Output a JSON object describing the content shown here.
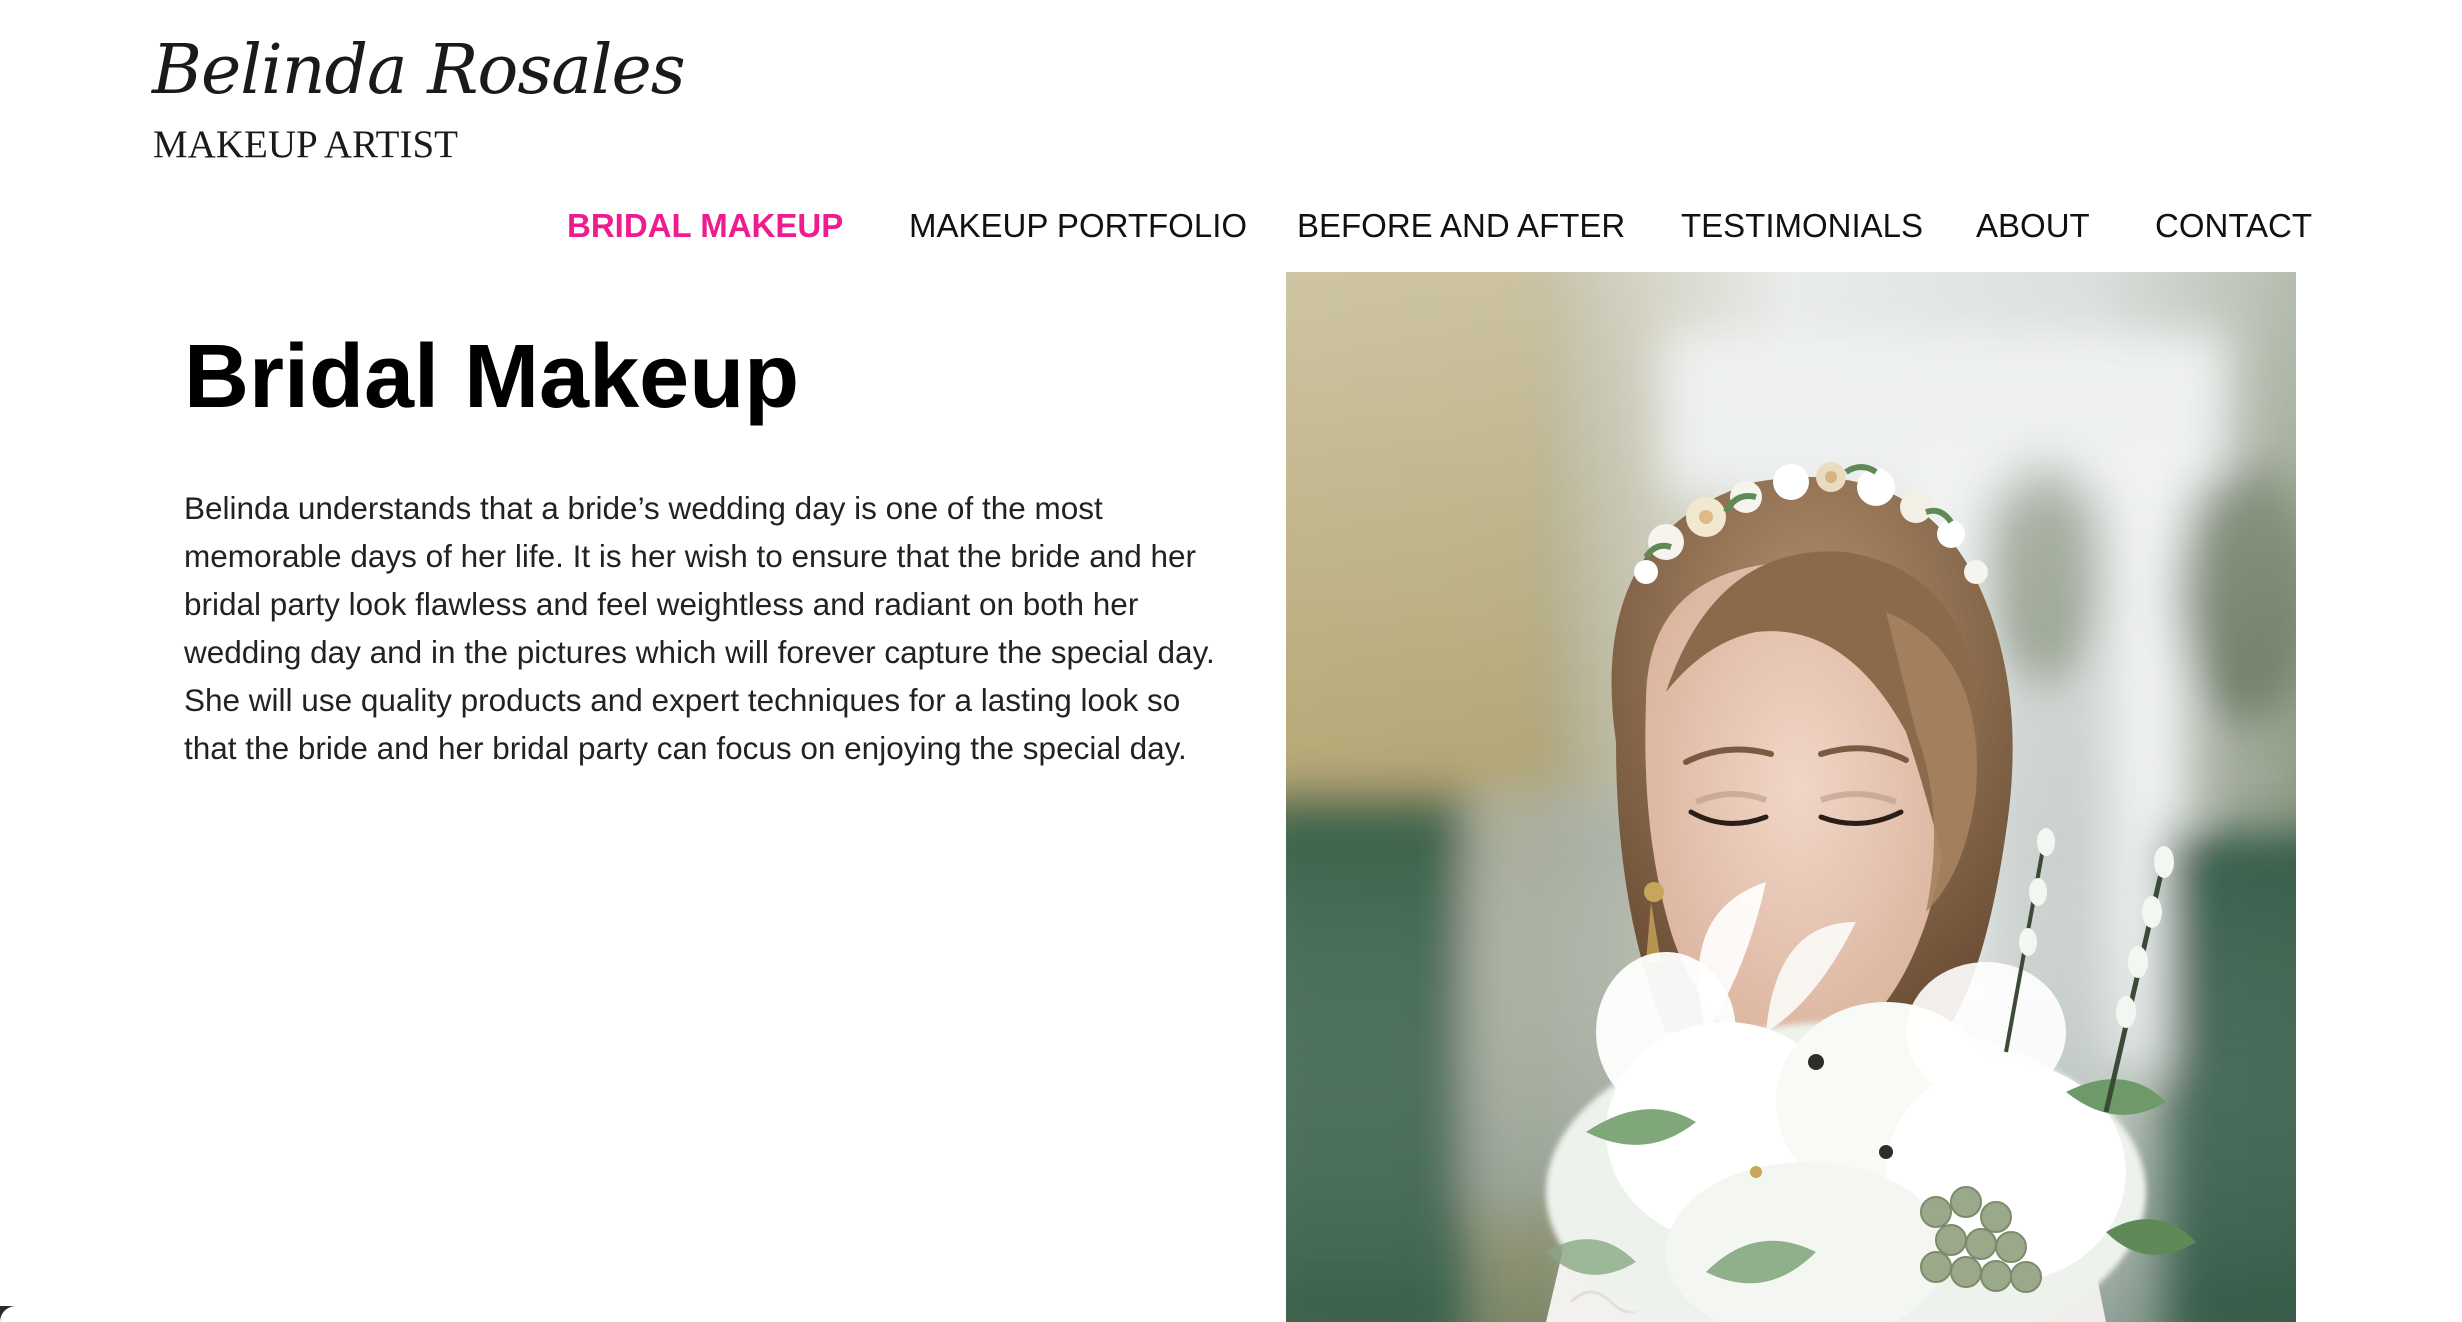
{
  "header": {
    "brand_name": "Belinda Rosales",
    "tagline": "MAKEUP ARTIST"
  },
  "nav": {
    "items": [
      {
        "label": "BRIDAL MAKEUP",
        "active": true
      },
      {
        "label": "MAKEUP PORTFOLIO",
        "active": false
      },
      {
        "label": "BEFORE AND AFTER",
        "active": false
      },
      {
        "label": "TESTIMONIALS",
        "active": false
      },
      {
        "label": "ABOUT",
        "active": false
      },
      {
        "label": "CONTACT",
        "active": false
      }
    ]
  },
  "main": {
    "title": "Bridal Makeup",
    "body": "Belinda understands that a bride’s wedding day is one of the most memorable days of her life. It is her wish to ensure that the bride and her bridal party look flawless and feel weightless and radiant on both her wedding day and in the pictures which will forever capture the special day. She will use quality products and expert techniques for a lasting look so that the bride and her bridal party can focus on enjoying the special day.",
    "photo_subject": "bride holding white bouquet"
  },
  "colors": {
    "accent": "#ee1c8e",
    "text": "#111111",
    "background": "#ffffff"
  }
}
